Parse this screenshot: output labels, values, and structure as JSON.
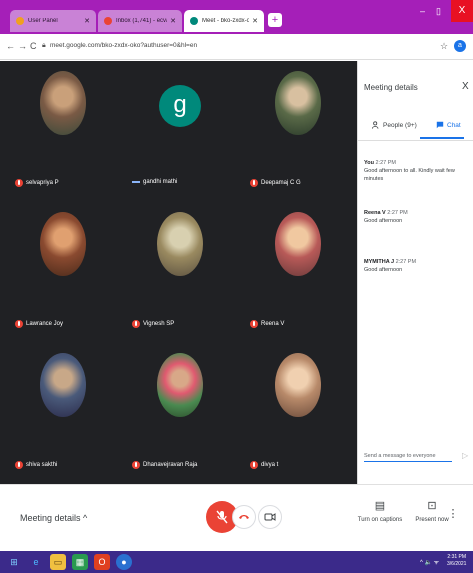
{
  "browser": {
    "tabs": [
      {
        "title": "User Panel",
        "favicon_color": "#f0a020",
        "active": false
      },
      {
        "title": "Inbox (1,741) - ecva02018@gmail.com",
        "favicon_color": "#ea4335",
        "active": false
      },
      {
        "title": "Meet - bko-zxdx-oko",
        "favicon_color": "#00897b",
        "active": true
      }
    ],
    "new_tab": "+",
    "url": "meet.google.com/bko-zxdx-oko?authuser=0&hl=en",
    "account_initial": "a",
    "minimize": "–",
    "maximize": "▯",
    "close": "X"
  },
  "participants": [
    {
      "name": "selvapriya P",
      "muted": true,
      "avatar_color": "#7a5a45"
    },
    {
      "name": "gandhi mathi",
      "muted": false,
      "avatar_letter": "g",
      "avatar_color": "#00897b"
    },
    {
      "name": "Deepamaj C G",
      "muted": true,
      "avatar_color": "#5a6a48"
    },
    {
      "name": "Lawrance Joy",
      "muted": true,
      "avatar_color": "#8a4a30"
    },
    {
      "name": "Vignesh SP",
      "muted": true,
      "avatar_color": "#9a8a60"
    },
    {
      "name": "Reena V",
      "muted": true,
      "avatar_color": "#b85a58"
    },
    {
      "name": "shiva sakthi",
      "muted": true,
      "avatar_color": "#4a5a7a"
    },
    {
      "name": "Dhanavejravan Raja",
      "muted": true,
      "avatar_color": "#4a8a50"
    },
    {
      "name": "divya t",
      "muted": true,
      "avatar_color": "#b88a6a"
    }
  ],
  "panel": {
    "title": "Meeting details",
    "close": "X",
    "tab_people": "People (9+)",
    "tab_chat": "Chat",
    "messages": [
      {
        "sender": "You",
        "time": "2:27 PM",
        "text": "Good afternoon to all. Kindly wait few minutes"
      },
      {
        "sender": "Reena V",
        "time": "2:27 PM",
        "text": "Good afternoon"
      },
      {
        "sender": "MYMITHA J",
        "time": "2:27 PM",
        "text": "Good afternoon"
      }
    ],
    "input_placeholder": "Send a message to everyone",
    "send": "▷"
  },
  "bottom": {
    "meeting_details": "Meeting details ^",
    "captions": "Turn on captions",
    "present": "Present now",
    "more": "⋮"
  },
  "taskbar": {
    "time": "2:31 PM",
    "date": "3/6/2021",
    "tray": "^ 🔈 ᯤ"
  }
}
